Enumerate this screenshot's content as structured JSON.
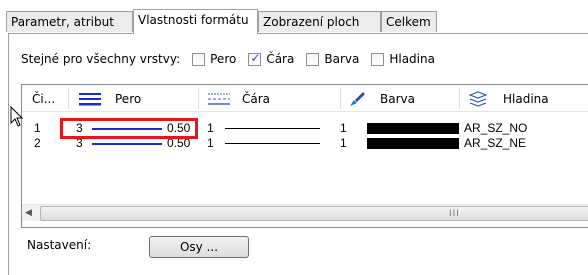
{
  "tabs": [
    {
      "label": "Parametr, atribut"
    },
    {
      "label": "Vlastnosti formátu",
      "active": true
    },
    {
      "label": "Zobrazení ploch"
    },
    {
      "label": "Celkem"
    }
  ],
  "same_for_all": {
    "label": "Stejné pro všechny vrstvy:",
    "options": [
      {
        "label": "Pero",
        "checked": false
      },
      {
        "label": "Čára",
        "checked": true
      },
      {
        "label": "Barva",
        "checked": false
      },
      {
        "label": "Hladina",
        "checked": false
      }
    ]
  },
  "table": {
    "columns": [
      {
        "label": "Či...",
        "icon": null
      },
      {
        "label": "Pero",
        "icon": "pen-lines-icon"
      },
      {
        "label": "Čára",
        "icon": "line-styles-icon"
      },
      {
        "label": "Barva",
        "icon": "paint-brush-icon"
      },
      {
        "label": "Hladina",
        "icon": "layers-icon"
      }
    ],
    "rows": [
      {
        "num": "1",
        "pen": "3",
        "pen_width": "0.50",
        "line": "1",
        "color": "#000000",
        "layer": "AR_SZ_NO"
      },
      {
        "num": "2",
        "pen": "3",
        "pen_width": "0.50",
        "line": "1",
        "color": "#000000",
        "layer": "AR_SZ_NE"
      }
    ],
    "scrollbar_grip": "III"
  },
  "settings": {
    "label": "Nastavení:",
    "button_label": "Osy ..."
  },
  "colors": {
    "highlight": "#e8141e",
    "pen_line": "#1a2bd6"
  }
}
